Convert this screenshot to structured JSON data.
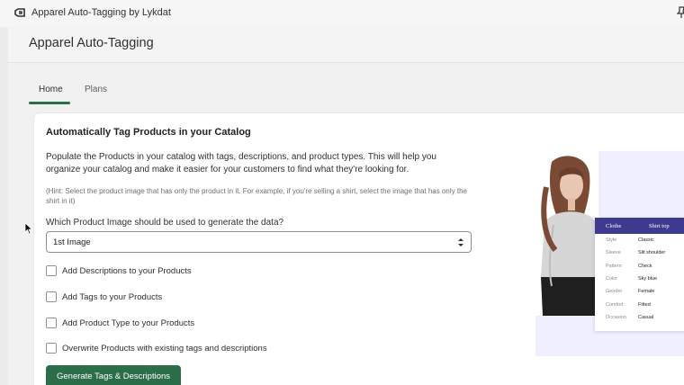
{
  "topbar": {
    "app_title": "Apparel Auto-Tagging by Lykdat",
    "app_icon": "app-logo-icon",
    "pin_icon": "pin-icon"
  },
  "page": {
    "title": "Apparel Auto-Tagging"
  },
  "tabs": [
    {
      "label": "Home",
      "active": true
    },
    {
      "label": "Plans",
      "active": false
    }
  ],
  "card": {
    "title": "Automatically Tag Products in your Catalog",
    "description": "Populate the Products in your catalog with tags, descriptions, and product types. This will help you organize your catalog and make it easier for your customers to find what they're looking for.",
    "hint": "(Hint: Select the product image that has only the product in it. For example, if you're selling a shirt, select the image that has only the shirt in it)",
    "select_label": "Which Product Image should be used to generate the data?",
    "select_value": "1st Image",
    "options": [
      {
        "label": "Add Descriptions to your Products",
        "checked": false
      },
      {
        "label": "Add Tags to your Products",
        "checked": false
      },
      {
        "label": "Add Product Type to your Products",
        "checked": false
      },
      {
        "label": "Overwrite Products with existing tags and descriptions",
        "checked": false
      }
    ],
    "button_label": "Generate Tags & Descriptions"
  },
  "preview": {
    "header": {
      "key": "Clothe",
      "value": "Shirt top"
    },
    "attributes": [
      {
        "key": "Style",
        "value": "Classic"
      },
      {
        "key": "Sleeve",
        "value": "Slit shoulder"
      },
      {
        "key": "Pattern",
        "value": "Check"
      },
      {
        "key": "Color",
        "value": "Sky blue"
      },
      {
        "key": "Gender",
        "value": "Female"
      },
      {
        "key": "Comfort",
        "value": "Fitted"
      },
      {
        "key": "Occasion",
        "value": "Casual"
      }
    ]
  },
  "colors": {
    "accent": "#2c6e49",
    "panel_header": "#3e3b8f",
    "preview_bg": "#f0efff"
  }
}
